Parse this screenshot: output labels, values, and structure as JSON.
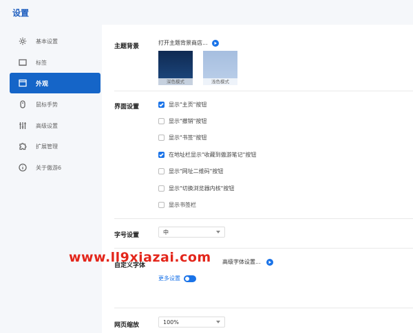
{
  "window": {
    "title": "设置"
  },
  "sidebar": {
    "items": [
      {
        "label": "基本设置",
        "icon": "gear-icon",
        "active": false
      },
      {
        "label": "标签",
        "icon": "tab-icon",
        "active": false
      },
      {
        "label": "外观",
        "icon": "window-icon",
        "active": true
      },
      {
        "label": "鼠标手势",
        "icon": "mouse-icon",
        "active": false
      },
      {
        "label": "高级设置",
        "icon": "sliders-icon",
        "active": false
      },
      {
        "label": "扩展管理",
        "icon": "puzzle-icon",
        "active": false
      },
      {
        "label": "关于傲游6",
        "icon": "info-icon",
        "active": false
      }
    ]
  },
  "theme": {
    "label": "主题背景",
    "open_store": "打开主题背景商店...",
    "dark_caption": "深色模式",
    "light_caption": "浅色模式"
  },
  "interface": {
    "label": "界面设置",
    "options": [
      {
        "label": "显示\"主页\"按钮",
        "checked": true
      },
      {
        "label": "显示\"撤销\"按钮",
        "checked": false
      },
      {
        "label": "显示\"书签\"按钮",
        "checked": false
      },
      {
        "label": "在地址栏显示\"收藏到傲游笔记\"按钮",
        "checked": true
      },
      {
        "label": "显示\"网址二维码\"按钮",
        "checked": false
      },
      {
        "label": "显示\"切换浏览器内核\"按钮",
        "checked": false
      },
      {
        "label": "显示书签栏",
        "checked": false
      }
    ]
  },
  "font_size": {
    "label": "字号设置",
    "value": "中"
  },
  "custom_font": {
    "label": "自定义字体",
    "advanced_link": "高级字体设置...",
    "more_settings": "更多设置"
  },
  "zoom": {
    "label": "网页缩放",
    "value": "100%"
  },
  "watermark": {
    "text": "www.ll9xiazai.com"
  },
  "colors": {
    "accent": "#1565c8",
    "watermark": "#e3261b"
  }
}
